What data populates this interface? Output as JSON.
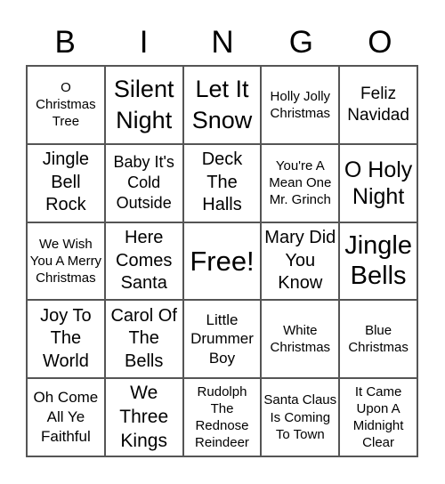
{
  "header": [
    "B",
    "I",
    "N",
    "G",
    "O"
  ],
  "cells": [
    "O Christmas Tree",
    "Silent Night",
    "Let It Snow",
    "Holly Jolly Christmas",
    "Feliz Navidad",
    "Jingle Bell Rock",
    "Baby It's Cold Outside",
    "Deck The Halls",
    "You're A Mean One Mr. Grinch",
    "O Holy Night",
    "We Wish You A Merry Christmas",
    "Here Comes Santa",
    "Free!",
    "Mary Did You Know",
    "Jingle Bells",
    "Joy To The World",
    "Carol Of The Bells",
    "Little Drummer Boy",
    "White Christmas",
    "Blue Christmas",
    "Oh Come All Ye Faithful",
    "We Three Kings",
    "Rudolph The Rednose Reindeer",
    "Santa Claus Is Coming To Town",
    "It Came Upon A Midnight Clear"
  ]
}
